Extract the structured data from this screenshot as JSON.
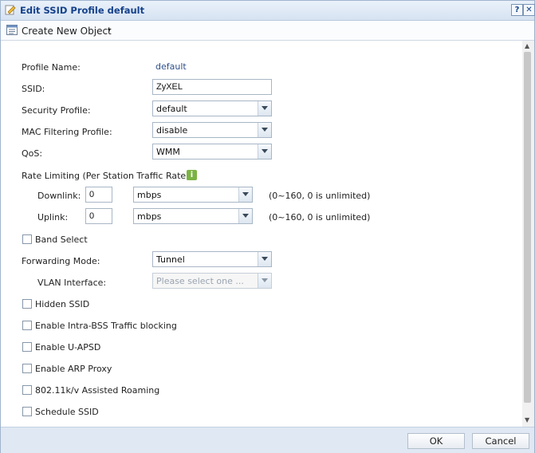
{
  "dialog": {
    "title": "Edit SSID Profile default",
    "help_label": "?",
    "close_label": "✕"
  },
  "toolbar": {
    "create_label": "Create New Object",
    "caret": "▾"
  },
  "form": {
    "profile_name": {
      "label": "Profile Name:",
      "value": "default"
    },
    "ssid": {
      "label": "SSID:",
      "value": "ZyXEL"
    },
    "security_profile": {
      "label": "Security Profile:",
      "value": "default"
    },
    "mac_filtering": {
      "label": "MAC Filtering Profile:",
      "value": "disable"
    },
    "qos": {
      "label": "QoS:",
      "value": "WMM"
    },
    "rate_limiting": {
      "label": "Rate Limiting (Per Station Traffic Rate)",
      "info": "i",
      "downlink": {
        "label": "Downlink:",
        "value": "0",
        "unit": "mbps",
        "hint": "(0~160, 0 is unlimited)"
      },
      "uplink": {
        "label": "Uplink:",
        "value": "0",
        "unit": "mbps",
        "hint": "(0~160, 0 is unlimited)"
      }
    },
    "band_select": {
      "label": "Band Select",
      "checked": false
    },
    "forwarding_mode": {
      "label": "Forwarding Mode:",
      "value": "Tunnel"
    },
    "vlan_interface": {
      "label": "VLAN Interface:",
      "placeholder": "Please select one ..."
    },
    "hidden_ssid": {
      "label": "Hidden SSID",
      "checked": false
    },
    "intra_bss": {
      "label": "Enable Intra-BSS Traffic blocking",
      "checked": false
    },
    "u_apsd": {
      "label": "Enable U-APSD",
      "checked": false
    },
    "arp_proxy": {
      "label": "Enable ARP Proxy",
      "checked": false
    },
    "roaming": {
      "label": "802.11k/v Assisted Roaming",
      "checked": false
    },
    "schedule": {
      "label": "Schedule SSID",
      "checked": false
    }
  },
  "buttons": {
    "ok": "OK",
    "cancel": "Cancel"
  },
  "colors": {
    "title_text": "#15428b",
    "footer_bg": "#dfe8f3",
    "info_icon": "#7cb342"
  }
}
